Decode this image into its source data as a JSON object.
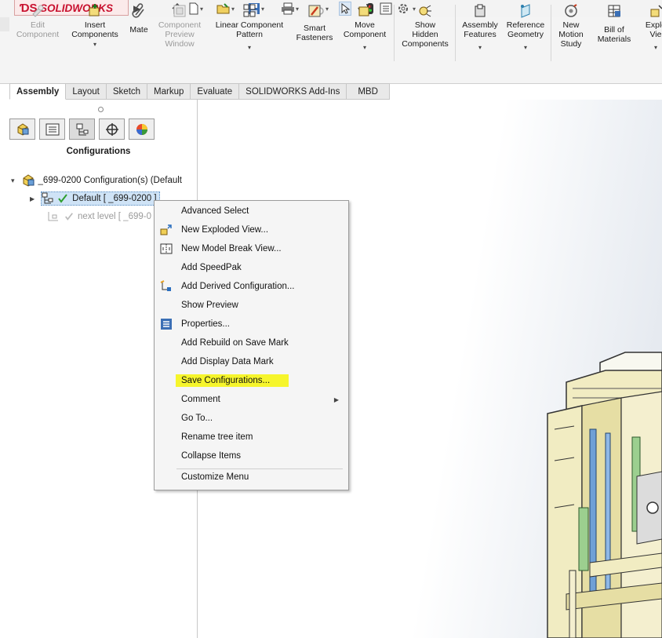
{
  "app": {
    "brand": "SOLIDWORKS"
  },
  "toolbar": {
    "tools": [
      {
        "label": "Edit\nComponent",
        "disabled": true,
        "dropdown": false
      },
      {
        "label": "Insert\nComponents",
        "disabled": false,
        "dropdown": true
      },
      {
        "label": "Mate",
        "disabled": false,
        "dropdown": false
      },
      {
        "label": "Component\nPreview\nWindow",
        "disabled": true,
        "dropdown": false
      },
      {
        "label": "Linear Component\nPattern",
        "disabled": false,
        "dropdown": true
      },
      {
        "label": "Smart\nFasteners",
        "disabled": false,
        "dropdown": false
      },
      {
        "label": "Move\nComponent",
        "disabled": false,
        "dropdown": true
      },
      {
        "label": "Show\nHidden\nComponents",
        "disabled": false,
        "dropdown": false
      },
      {
        "label": "Assembly\nFeatures",
        "disabled": false,
        "dropdown": true
      },
      {
        "label": "Reference\nGeometry",
        "disabled": false,
        "dropdown": true
      },
      {
        "label": "New\nMotion\nStudy",
        "disabled": false,
        "dropdown": false
      },
      {
        "label": "Bill of\nMaterials",
        "disabled": false,
        "dropdown": false
      },
      {
        "label": "Explo\nVie",
        "disabled": false,
        "dropdown": true
      }
    ]
  },
  "tabs": [
    "Assembly",
    "Layout",
    "Sketch",
    "Markup",
    "Evaluate",
    "SOLIDWORKS Add-Ins",
    "MBD"
  ],
  "active_tab": "Assembly",
  "panel": {
    "title": "Configurations",
    "tree": {
      "root": "_699-0200 Configuration(s)  (Default",
      "items": [
        {
          "label": "Default [ _699-0200 ]",
          "selected": true
        },
        {
          "label": "next level [ _699-0",
          "selected": false
        }
      ]
    }
  },
  "context_menu": {
    "items": [
      {
        "label": "Advanced Select",
        "icon": "none",
        "submenu": false,
        "highlighted": false
      },
      {
        "label": "New Exploded View...",
        "icon": "exploded-view-icon",
        "submenu": false,
        "highlighted": false
      },
      {
        "label": "New Model Break View...",
        "icon": "model-break-icon",
        "submenu": false,
        "highlighted": false
      },
      {
        "label": "Add SpeedPak",
        "icon": "none",
        "submenu": false,
        "highlighted": false
      },
      {
        "label": "Add Derived Configuration...",
        "icon": "derived-config-icon",
        "submenu": false,
        "highlighted": false
      },
      {
        "label": "Show Preview",
        "icon": "none",
        "submenu": false,
        "highlighted": false
      },
      {
        "label": "Properties...",
        "icon": "properties-icon",
        "submenu": false,
        "highlighted": false
      },
      {
        "label": "Add Rebuild on Save Mark",
        "icon": "none",
        "submenu": false,
        "highlighted": false
      },
      {
        "label": "Add Display Data Mark",
        "icon": "none",
        "submenu": false,
        "highlighted": false
      },
      {
        "label": "Save Configurations...",
        "icon": "none",
        "submenu": false,
        "highlighted": true
      },
      {
        "label": "Comment",
        "icon": "none",
        "submenu": true,
        "highlighted": false
      },
      {
        "label": "Go To...",
        "icon": "none",
        "submenu": false,
        "highlighted": false
      },
      {
        "label": "Rename tree item",
        "icon": "none",
        "submenu": false,
        "highlighted": false
      },
      {
        "label": "Collapse Items",
        "icon": "none",
        "submenu": false,
        "highlighted": false
      },
      {
        "label": "Customize Menu",
        "icon": "none",
        "submenu": false,
        "highlighted": false
      }
    ],
    "highlight_color": "#f6f52c"
  },
  "colors": {
    "brand_red": "#c8102e",
    "selection": "#cfe3f6",
    "model_frame": "#f1ecc2",
    "check_green": "#2e9e2e"
  }
}
